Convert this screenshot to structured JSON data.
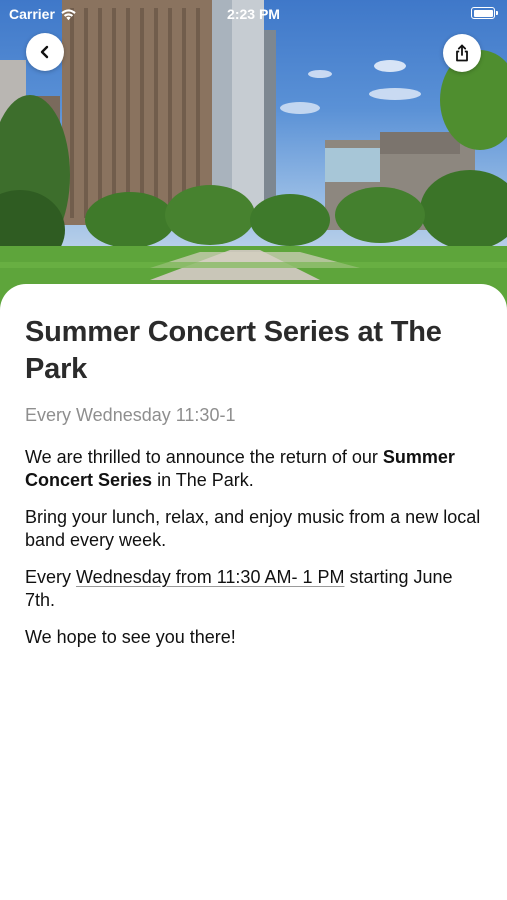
{
  "status_bar": {
    "carrier": "Carrier",
    "time": "2:23 PM",
    "icons": [
      "wifi-icon",
      "battery-icon"
    ]
  },
  "hero": {
    "image_semantic": "city-park-with-high-rise-buildings",
    "buttons": [
      "back-chevron-icon",
      "share-icon"
    ]
  },
  "event": {
    "title": "Summer Concert Series at The Park",
    "subtitle": "Every Wednesday 11:30-1",
    "p1_before": "We are thrilled to announce the return of our ",
    "p1_bold": "Summer Concert Series",
    "p1_after": " in The Park.",
    "p2": "Bring your lunch, relax, and enjoy music from a new local band every week.",
    "p3_before": "Every ",
    "p3_link": "Wednesday from 11:30 AM- 1 PM",
    "p3_after": " starting June 7th.",
    "p4": "We hope to see you there!"
  },
  "colors": {
    "sheet_background": "#ffffff",
    "title": "#2b2b2b",
    "subtitle": "#8e8e8e",
    "body": "#111111"
  }
}
